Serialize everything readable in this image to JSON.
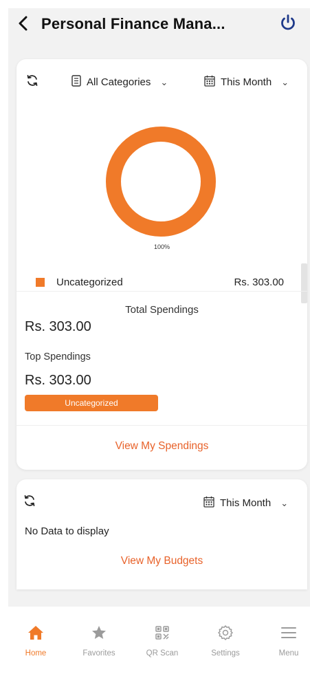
{
  "header": {
    "title": "Personal Finance Mana...",
    "back_icon": "chevron-left-icon",
    "power_icon": "power-icon"
  },
  "colors": {
    "accent": "#f07a29",
    "link": "#e8622a",
    "nav_active": "#f07a29",
    "nav_inactive": "#9b9b9b",
    "power": "#1f3a8a"
  },
  "spendings_card": {
    "category_filter": "All Categories",
    "period_filter": "This Month",
    "donut": {
      "slices": [
        {
          "name": "Uncategorized",
          "percent": 100,
          "label": "100%"
        }
      ]
    },
    "legend": [
      {
        "name": "Uncategorized",
        "amount": "Rs. 303.00"
      }
    ],
    "total_title": "Total Spendings",
    "total_amount": "Rs. 303.00",
    "top_title": "Top Spendings",
    "top_amount": "Rs. 303.00",
    "top_category": "Uncategorized",
    "link_label": "View My Spendings"
  },
  "budgets_card": {
    "period_filter": "This Month",
    "empty_text": "No Data to display",
    "link_label": "View My Budgets"
  },
  "bottom_nav": {
    "items": [
      {
        "label": "Home",
        "icon": "home-icon",
        "active": true
      },
      {
        "label": "Favorites",
        "icon": "star-icon",
        "active": false
      },
      {
        "label": "QR Scan",
        "icon": "qr-code-icon",
        "active": false
      },
      {
        "label": "Settings",
        "icon": "gear-icon",
        "active": false
      },
      {
        "label": "Menu",
        "icon": "menu-icon",
        "active": false
      }
    ]
  }
}
